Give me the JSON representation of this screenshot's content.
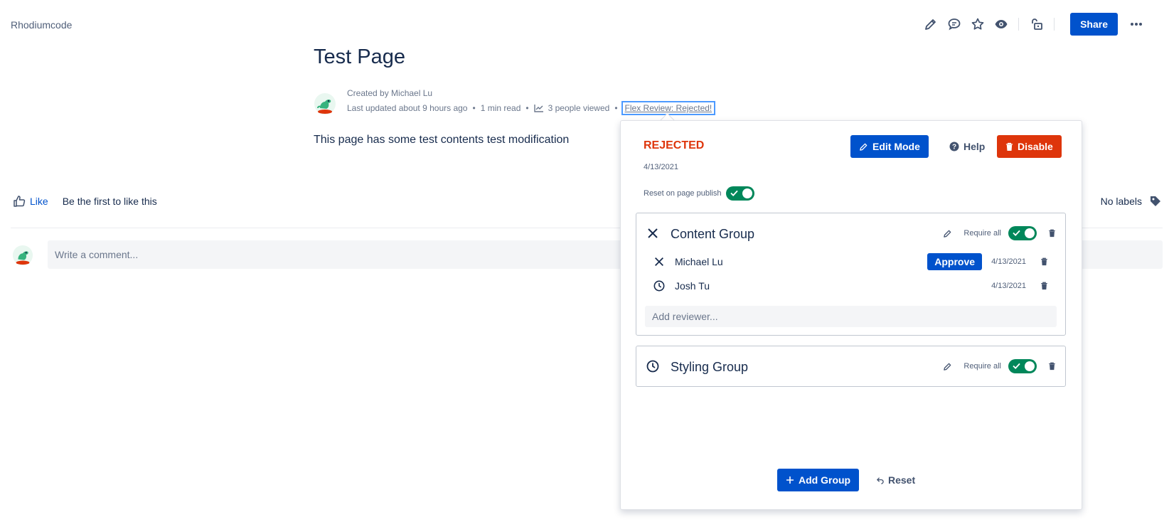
{
  "header": {
    "space_name": "Rhodiumcode",
    "share_label": "Share",
    "icons": [
      "edit-icon",
      "comment-icon",
      "star-icon",
      "watch-icon",
      "restrictions-icon",
      "more-icon"
    ]
  },
  "page": {
    "title": "Test Page",
    "created_by": "Created by Michael Lu",
    "last_updated": "Last updated about 9 hours ago",
    "read_time": "1 min read",
    "viewed": "3 people viewed",
    "flex_review_link": "Flex Review: Rejected!",
    "body": "This page has some test contents test modification"
  },
  "footer": {
    "like_label": "Like",
    "like_hint": "Be the first to like this",
    "labels_text": "No labels",
    "comment_placeholder": "Write a comment..."
  },
  "review_popup": {
    "status": "REJECTED",
    "status_date": "4/13/2021",
    "edit_mode_label": "Edit Mode",
    "help_label": "Help",
    "disable_label": "Disable",
    "reset_on_publish_label": "Reset on page publish",
    "reset_on_publish_enabled": true,
    "groups": [
      {
        "name": "Content Group",
        "require_all_label": "Require all",
        "require_all": true,
        "reviewers": [
          {
            "name": "Michael Lu",
            "status": "rejected",
            "action_label": "Approve",
            "date": "4/13/2021"
          },
          {
            "name": "Josh Tu",
            "status": "pending",
            "date": "4/13/2021"
          }
        ],
        "add_reviewer_placeholder": "Add reviewer..."
      },
      {
        "name": "Styling Group",
        "require_all_label": "Require all",
        "require_all": true
      }
    ],
    "add_group_label": "Add Group",
    "reset_label": "Reset"
  },
  "colors": {
    "primary": "#0052cc",
    "danger": "#de350b",
    "toggle_on": "#00875a"
  }
}
